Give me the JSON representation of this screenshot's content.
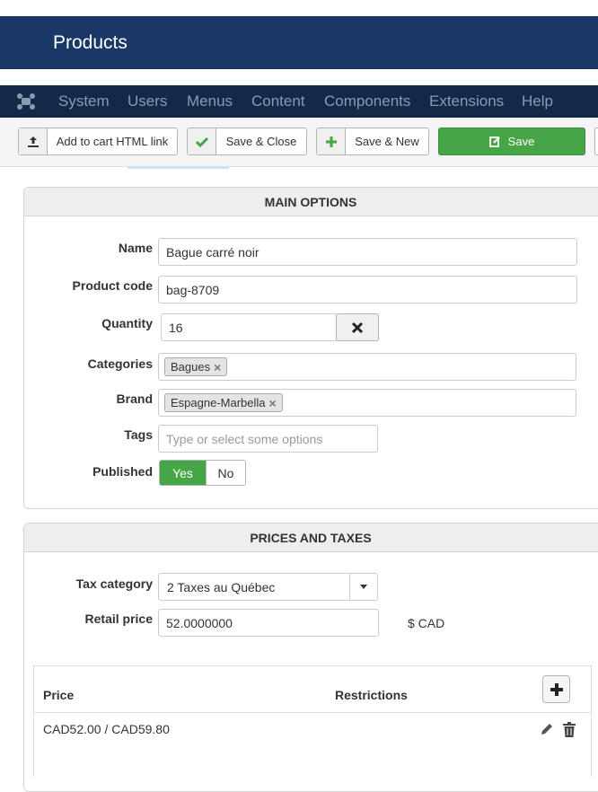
{
  "page_title": "Products",
  "nav": {
    "items": [
      "System",
      "Users",
      "Menus",
      "Content",
      "Components",
      "Extensions",
      "Help"
    ]
  },
  "toolbar": {
    "add_to_cart_label": "Add to cart HTML link",
    "save_close_label": "Save & Close",
    "save_new_label": "Save & New",
    "save_label": "Save"
  },
  "main_options": {
    "heading": "MAIN OPTIONS",
    "name_label": "Name",
    "name_value": "Bague carré noir",
    "code_label": "Product code",
    "code_value": "bag-8709",
    "quantity_label": "Quantity",
    "quantity_value": "16",
    "categories_label": "Categories",
    "categories": [
      "Bagues"
    ],
    "brand_label": "Brand",
    "brand": [
      "Espagne-Marbella"
    ],
    "tags_label": "Tags",
    "tags_placeholder": "Type or select some options",
    "published_label": "Published",
    "published_yes": "Yes",
    "published_no": "No",
    "published_value": "Yes"
  },
  "prices": {
    "heading": "PRICES AND TAXES",
    "tax_label": "Tax category",
    "tax_value": "2 Taxes au Québec",
    "retail_label": "Retail price",
    "retail_value": "52.0000000",
    "retail_unit": "$ CAD",
    "table": {
      "col_price": "Price",
      "col_restrictions": "Restrictions",
      "rows": [
        {
          "price": "CAD52.00 / CAD59.80",
          "restrictions": ""
        }
      ]
    }
  },
  "colors": {
    "title_bar": "#1a3867",
    "nav_bar": "#13294a",
    "accent_green": "#46a546"
  }
}
